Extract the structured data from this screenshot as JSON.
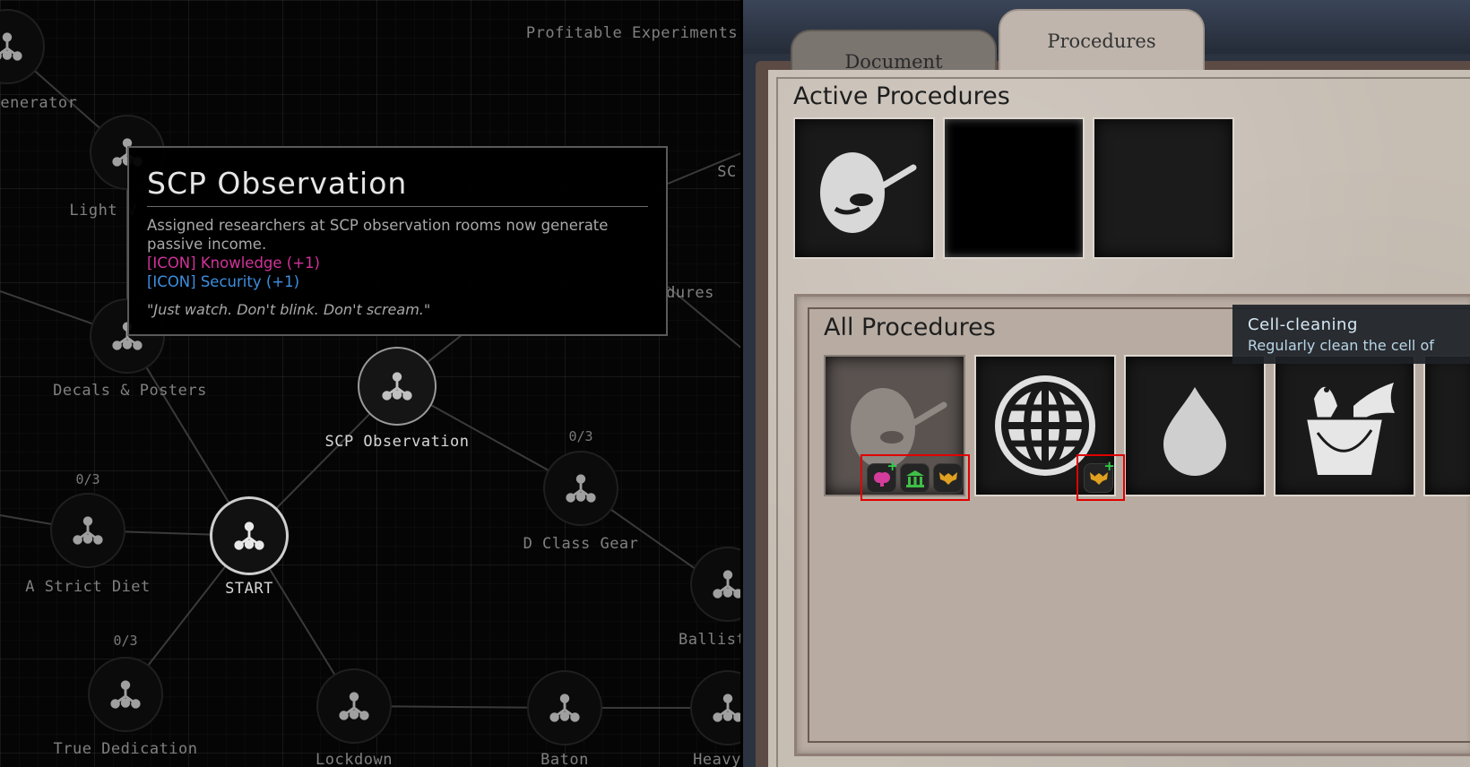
{
  "tree": {
    "top_label": "Profitable Experiments",
    "nodes": [
      {
        "label": "Generator"
      },
      {
        "label": "Light V"
      },
      {
        "label": "Decals & Posters"
      },
      {
        "label": "SCP Observation"
      },
      {
        "label": "A Strict Diet",
        "count": "0/3"
      },
      {
        "label": "START"
      },
      {
        "label": "D Class Gear",
        "count": "0/3"
      },
      {
        "label": "True Dedication",
        "count": "0/3"
      },
      {
        "label": "Lockdown"
      },
      {
        "label": "Baton"
      },
      {
        "label": "Ballisti"
      },
      {
        "label": "Heavy"
      },
      {
        "label": "SC"
      },
      {
        "label": "dures"
      }
    ]
  },
  "tooltip": {
    "title": "SCP Observation",
    "description": "Assigned researchers at SCP observation rooms now generate passive income.",
    "knowledge": "[ICON] Knowledge (+1)",
    "security": "[ICON] Security (+1)",
    "quote": "\"Just watch. Don't blink. Don't scream.\""
  },
  "tabs": {
    "document": "Document",
    "procedures": "Procedures"
  },
  "procedures": {
    "active_title": "Active Procedures",
    "all_title": "All Procedures",
    "active_cards": [
      "feeding-icon",
      "empty-black",
      "empty"
    ],
    "all_cards": [
      "feeding-icon",
      "globe-icon",
      "water-drop-icon",
      "bucket-fish-icon"
    ],
    "tooltip_title": "Cell-cleaning",
    "tooltip_desc": "Regularly clean the cell of"
  },
  "colors": {
    "knowledge": "#d2339a",
    "security": "#3d8fe0",
    "highlight": "#e00000",
    "plus": "#2fd14a"
  }
}
